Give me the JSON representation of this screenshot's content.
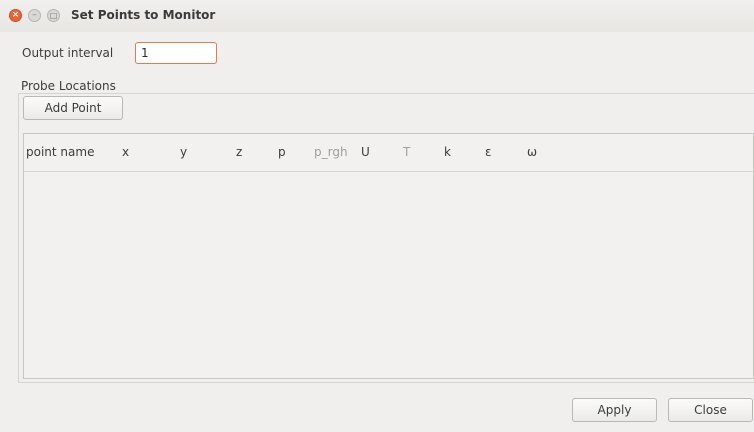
{
  "window": {
    "title": "Set Points to Monitor",
    "close_glyph": "×",
    "minimize_glyph": "–",
    "maximize_glyph": "□"
  },
  "output_interval": {
    "label": "Output interval",
    "value": "1"
  },
  "probe_group": {
    "label": "Probe Locations"
  },
  "add_point_button": "Add Point",
  "table": {
    "columns": [
      {
        "label": "point name",
        "enabled": true
      },
      {
        "label": "x",
        "enabled": true
      },
      {
        "label": "y",
        "enabled": true
      },
      {
        "label": "z",
        "enabled": true
      },
      {
        "label": "p",
        "enabled": true
      },
      {
        "label": "p_rgh",
        "enabled": false
      },
      {
        "label": "U",
        "enabled": true
      },
      {
        "label": "T",
        "enabled": false
      },
      {
        "label": "k",
        "enabled": true
      },
      {
        "label": "ε",
        "enabled": true
      },
      {
        "label": "ω",
        "enabled": true
      }
    ],
    "rows": []
  },
  "apply_button": "Apply",
  "close_button": "Close"
}
